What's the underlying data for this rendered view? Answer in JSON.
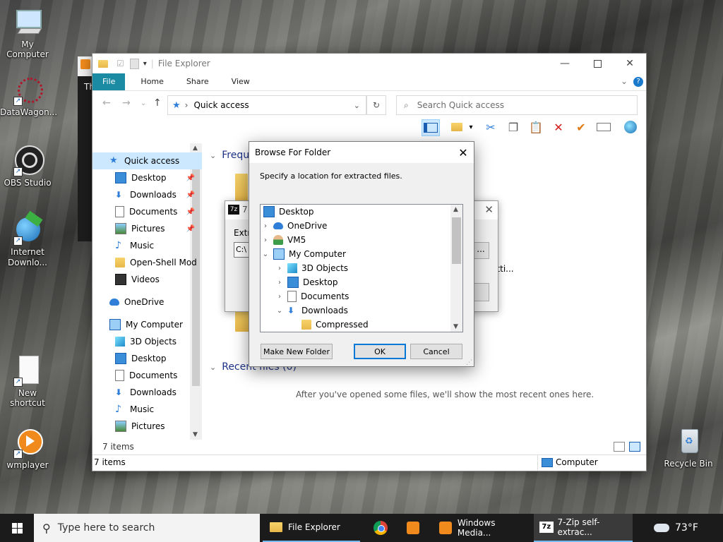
{
  "desktop": {
    "icons": [
      {
        "label": "My Computer",
        "icon": "computer-icon"
      },
      {
        "label": "DataWagon...",
        "icon": "datawagon-icon"
      },
      {
        "label": "OBS Studio",
        "icon": "obs-icon"
      },
      {
        "label": "Internet Downlo...",
        "icon": "idm-icon"
      },
      {
        "label": "New shortcut",
        "icon": "blank-file-icon"
      },
      {
        "label": "wmplayer",
        "icon": "wmplayer-icon"
      },
      {
        "label": "Recycle Bin",
        "icon": "recycle-bin-icon"
      }
    ],
    "behind_letter": "Th"
  },
  "explorer": {
    "title": "File Explorer",
    "tabs": [
      "File",
      "Home",
      "Share",
      "View"
    ],
    "address": "Quick access",
    "search_placeholder": "Search Quick access",
    "nav": [
      {
        "label": "Quick access",
        "icon": "star-icon",
        "selected": true
      },
      {
        "label": "Desktop",
        "icon": "desktop-icon",
        "pinned": true
      },
      {
        "label": "Downloads",
        "icon": "download-icon",
        "pinned": true
      },
      {
        "label": "Documents",
        "icon": "document-icon",
        "pinned": true
      },
      {
        "label": "Pictures",
        "icon": "pictures-icon",
        "pinned": true
      },
      {
        "label": "Music",
        "icon": "music-icon"
      },
      {
        "label": "Open-Shell Mod",
        "icon": "folder-icon"
      },
      {
        "label": "Videos",
        "icon": "video-icon"
      },
      {
        "label": "OneDrive",
        "icon": "cloud-icon"
      },
      {
        "label": "My Computer",
        "icon": "computer-icon"
      },
      {
        "label": "3D Objects",
        "icon": "cube-icon"
      },
      {
        "label": "Desktop",
        "icon": "desktop-icon"
      },
      {
        "label": "Documents",
        "icon": "document-icon"
      },
      {
        "label": "Downloads",
        "icon": "download-icon"
      },
      {
        "label": "Music",
        "icon": "music-icon"
      },
      {
        "label": "Pictures",
        "icon": "pictures-icon"
      }
    ],
    "sections": {
      "frequent": "Freque",
      "recent": "Recent files (0)",
      "recent_empty": "After you've opened some files, we'll show the most recent ones here."
    },
    "partial_texts": {
      "er": "er",
      "settings": "n Setti..."
    },
    "status_items": "7 items",
    "status_items_bottom": "7 items",
    "status_computer": "Computer"
  },
  "sevenzip": {
    "title": "7",
    "extract_label": "Extra",
    "path_value": "C:\\",
    "browse_btn": "..."
  },
  "browse_dialog": {
    "title": "Browse For Folder",
    "prompt": "Specify a location for extracted files.",
    "tree": [
      {
        "label": "Desktop",
        "icon": "desktop-icon",
        "expander": "",
        "indent": 0,
        "selected": false
      },
      {
        "label": "OneDrive",
        "icon": "cloud-icon",
        "expander": "›",
        "indent": 0
      },
      {
        "label": "VM5",
        "icon": "user-icon",
        "expander": "›",
        "indent": 0
      },
      {
        "label": "My Computer",
        "icon": "computer-icon",
        "expander": "⌄",
        "indent": 0
      },
      {
        "label": "3D Objects",
        "icon": "cube-icon",
        "expander": "›",
        "indent": 1
      },
      {
        "label": "Desktop",
        "icon": "desktop-icon",
        "expander": "›",
        "indent": 1
      },
      {
        "label": "Documents",
        "icon": "document-icon",
        "expander": "›",
        "indent": 1
      },
      {
        "label": "Downloads",
        "icon": "download-icon",
        "expander": "⌄",
        "indent": 1
      },
      {
        "label": "Compressed",
        "icon": "folder-icon",
        "expander": "",
        "indent": 2
      }
    ],
    "buttons": {
      "new_folder": "Make New Folder",
      "ok": "OK",
      "cancel": "Cancel"
    }
  },
  "taskbar": {
    "search_placeholder": "Type here to search",
    "items": [
      {
        "label": "File Explorer",
        "icon": "folder-icon"
      },
      {
        "label": "",
        "icon": "chrome-icon"
      },
      {
        "label": "",
        "icon": "media-player-icon"
      },
      {
        "label": "Windows Media...",
        "icon": "media-player-icon"
      },
      {
        "label": "7-Zip self-extrac...",
        "icon": "7zip-icon"
      }
    ],
    "weather": "73°F"
  },
  "colors": {
    "accent": "#0078d7",
    "file_tab": "#1b8aa3",
    "selection": "#cce8ff"
  }
}
